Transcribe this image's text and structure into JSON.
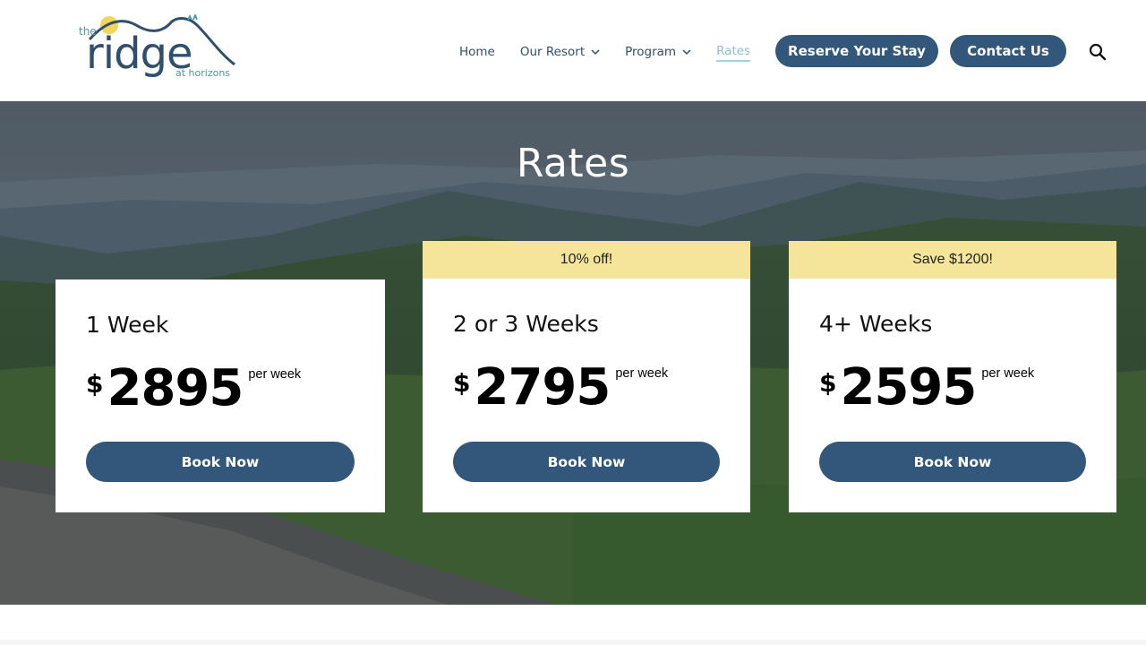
{
  "brand": {
    "logo_text_the": "the",
    "logo_text_main": "ridge",
    "logo_text_sub": "at horizons"
  },
  "nav": {
    "items": [
      {
        "label": "Home",
        "dropdown": false
      },
      {
        "label": "Our Resort",
        "dropdown": true
      },
      {
        "label": "Program",
        "dropdown": true
      },
      {
        "label": "Rates",
        "dropdown": false,
        "active": true
      }
    ],
    "reserve_label": "Reserve Your Stay",
    "contact_label": "Contact Us",
    "search_icon": "search-icon"
  },
  "hero": {
    "title": "Rates"
  },
  "pricing": [
    {
      "banner": "",
      "title": "1 Week",
      "currency": "$",
      "amount": "2895",
      "unit": "per week",
      "button": "Book Now"
    },
    {
      "banner": "10% off!",
      "title": "2 or 3 Weeks",
      "currency": "$",
      "amount": "2795",
      "unit": "per week",
      "button": "Book Now"
    },
    {
      "banner": "Save $1200!",
      "title": "4+ Weeks",
      "currency": "$",
      "amount": "2595",
      "unit": "per week",
      "button": "Book Now"
    }
  ],
  "colors": {
    "primary": "#33577a",
    "banner": "#f5e59b",
    "nav_text": "#2f4f6e",
    "nav_active": "#8ec0d6",
    "logo_teal": "#4a9a9a",
    "logo_sun": "#f2d55a"
  }
}
